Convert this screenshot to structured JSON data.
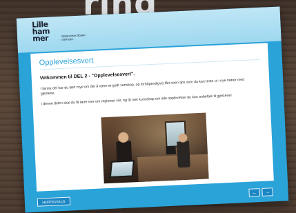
{
  "background": {
    "banner_text": "ring"
  },
  "brand": {
    "logo_lines": [
      "Lille",
      "ham",
      "mer"
    ],
    "tagline": "Opplevelser tilbake i nærheten"
  },
  "content": {
    "heading": "Opplevelsesvert",
    "welcome": "Velkommen til DEL 2 - \"Opplevelsesvert\".",
    "paragraph1": "I første del har du lært mye om det å være et godt vertskap, og forhåpentligvis fått noen tips som du kan teste ut i nye møter med gjestene.",
    "paragraph2": "I denne delen skal du få lære mer om regionen vår, og få mer kunnskap om alle opplevelser du kan anbefale til gjestene!"
  },
  "buttons": {
    "hurtigvalg": "HURTIGVALG",
    "prev": "←",
    "next": "→"
  },
  "colors": {
    "accent": "#2aa3d8",
    "button": "#1b86c4",
    "header_light": "#bfe6f5"
  }
}
